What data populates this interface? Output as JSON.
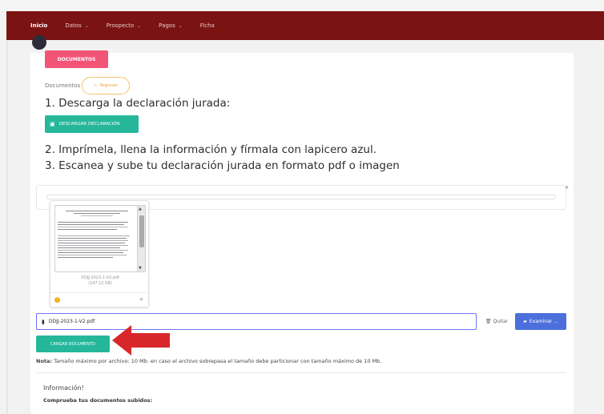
{
  "nav": {
    "items": [
      {
        "label": "Inicio",
        "active": true,
        "dropdown": false
      },
      {
        "label": "Datos",
        "active": false,
        "dropdown": true
      },
      {
        "label": "Prospecto",
        "active": false,
        "dropdown": true
      },
      {
        "label": "Pagos",
        "active": false,
        "dropdown": true
      },
      {
        "label": "Ficha",
        "active": false,
        "dropdown": false
      }
    ]
  },
  "section": {
    "badge": "DOCUMENTOS",
    "label": "Documentos",
    "back_button": "Regresar"
  },
  "steps": {
    "step1": "1. Descarga la declaración jurada:",
    "download_button": "DESCARGAR DECLARACIÓN",
    "step2": "2. Imprímela, llena la información y fírmala con lapicero azul.",
    "step3": "3. Escanea y sube tu declaración jurada en formato pdf o imagen"
  },
  "preview": {
    "filename": "DDJJ-2023-1-V2.pdf",
    "size": "(147.12 KB)"
  },
  "upload": {
    "file_value": "DDJJ-2023-1-V2.pdf",
    "remove_label": "Quitar",
    "browse_label": "Examinar ...",
    "submit_label": "CARGAR DOCUMENTO"
  },
  "note": {
    "prefix": "Nota:",
    "text": "Tamaño máximo por archivo: 10 Mb. en caso el archivo sobrepasa el tamaño debe particionar con tamaño máximo de 10 Mb."
  },
  "info": {
    "title": "Información!",
    "subtitle": "Comprueba tus documentos subidos:"
  },
  "colors": {
    "navbar": "#7a1412",
    "badge": "#f25477",
    "primary_green": "#26b79b",
    "browse_blue": "#4c6fdc",
    "arrow_red": "#d8272b"
  }
}
